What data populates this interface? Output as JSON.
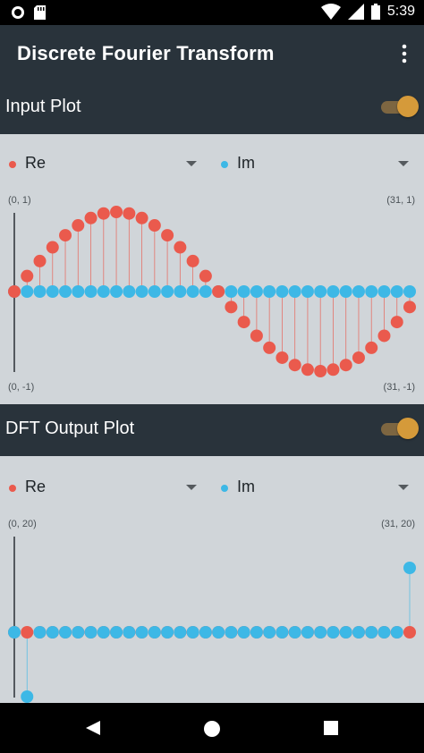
{
  "status_bar": {
    "time": "5:39",
    "icons": [
      "circle-notification-icon",
      "sd-card-icon",
      "wifi-icon",
      "signal-icon",
      "battery-icon"
    ]
  },
  "app_bar": {
    "title": "Discrete Fourier Transform",
    "menu_icon": "overflow-menu-icon"
  },
  "input_section": {
    "title": "Input Plot",
    "toggle_on": true
  },
  "input_plot": {
    "series_left": {
      "label": "Re",
      "color": "#ea5a4d"
    },
    "series_right": {
      "label": "Im",
      "color": "#3db8e6"
    },
    "top_left_label": "(0, 1)",
    "top_right_label": "(31, 1)",
    "bottom_left_label": "(0, -1)",
    "bottom_right_label": "(31, -1)"
  },
  "output_section": {
    "title": "DFT Output Plot",
    "toggle_on": true
  },
  "output_plot": {
    "series_left": {
      "label": "Re",
      "color": "#ea5a4d"
    },
    "series_right": {
      "label": "Im",
      "color": "#3db8e6"
    },
    "top_left_label": "(0, 20)",
    "top_right_label": "(31, 20)"
  },
  "colors": {
    "real": "#ea5a4d",
    "imag": "#3db8e6",
    "header_bg": "#29333b",
    "plot_bg": "#d0d5d9",
    "accent": "#d59a3a"
  },
  "chart_data": [
    {
      "type": "scatter",
      "name": "input",
      "x": [
        0,
        1,
        2,
        3,
        4,
        5,
        6,
        7,
        8,
        9,
        10,
        11,
        12,
        13,
        14,
        15,
        16,
        17,
        18,
        19,
        20,
        21,
        22,
        23,
        24,
        25,
        26,
        27,
        28,
        29,
        30,
        31
      ],
      "series": [
        {
          "name": "Re",
          "values": [
            0,
            0.195,
            0.383,
            0.556,
            0.707,
            0.831,
            0.924,
            0.981,
            1,
            0.981,
            0.924,
            0.831,
            0.707,
            0.556,
            0.383,
            0.195,
            0,
            -0.195,
            -0.383,
            -0.556,
            -0.707,
            -0.831,
            -0.924,
            -0.981,
            -1,
            -0.981,
            -0.924,
            -0.831,
            -0.707,
            -0.556,
            -0.383,
            -0.195
          ]
        },
        {
          "name": "Im",
          "values": [
            0,
            0,
            0,
            0,
            0,
            0,
            0,
            0,
            0,
            0,
            0,
            0,
            0,
            0,
            0,
            0,
            0,
            0,
            0,
            0,
            0,
            0,
            0,
            0,
            0,
            0,
            0,
            0,
            0,
            0,
            0,
            0
          ]
        }
      ],
      "xlim": [
        0,
        31
      ],
      "ylim": [
        -1,
        1
      ]
    },
    {
      "type": "scatter",
      "name": "dft_output",
      "x": [
        0,
        1,
        2,
        3,
        4,
        5,
        6,
        7,
        8,
        9,
        10,
        11,
        12,
        13,
        14,
        15,
        16,
        17,
        18,
        19,
        20,
        21,
        22,
        23,
        24,
        25,
        26,
        27,
        28,
        29,
        30,
        31
      ],
      "series": [
        {
          "name": "Re",
          "values": [
            0,
            0,
            0,
            0,
            0,
            0,
            0,
            0,
            0,
            0,
            0,
            0,
            0,
            0,
            0,
            0,
            0,
            0,
            0,
            0,
            0,
            0,
            0,
            0,
            0,
            0,
            0,
            0,
            0,
            0,
            0,
            0
          ]
        },
        {
          "name": "Im",
          "values": [
            0,
            -16,
            0,
            0,
            0,
            0,
            0,
            0,
            0,
            0,
            0,
            0,
            0,
            0,
            0,
            0,
            0,
            0,
            0,
            0,
            0,
            0,
            0,
            0,
            0,
            0,
            0,
            0,
            0,
            0,
            0,
            16
          ]
        }
      ],
      "xlim": [
        0,
        31
      ],
      "ylim": [
        -20,
        20
      ]
    }
  ]
}
